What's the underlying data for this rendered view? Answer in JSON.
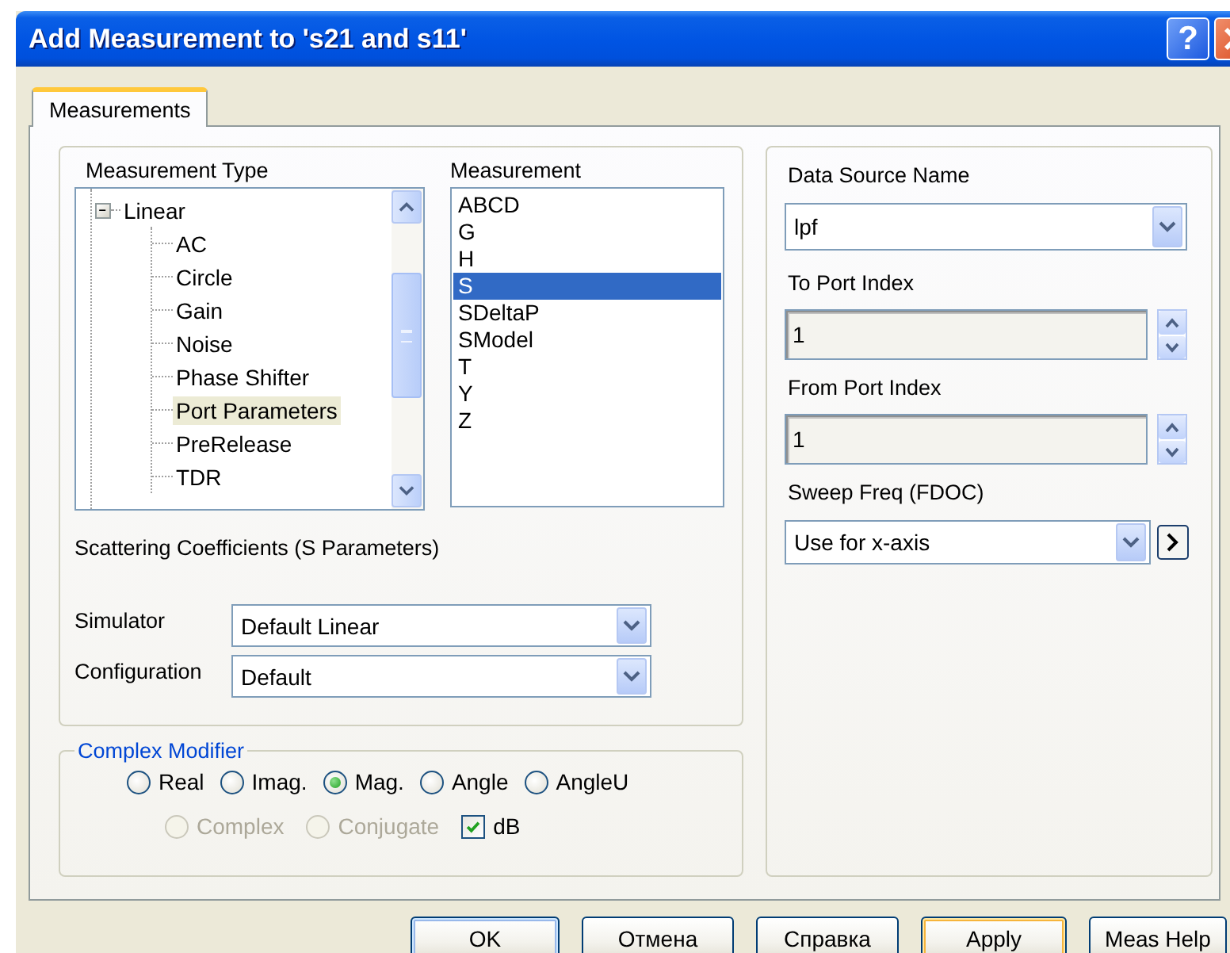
{
  "window": {
    "title": "Add Measurement to 's21 and s11'",
    "help_button": "?"
  },
  "tabs": [
    {
      "label": "Measurements",
      "selected": true
    }
  ],
  "measurement_type": {
    "label": "Measurement Type",
    "tree": [
      {
        "label": "Linear",
        "expanded": true,
        "selected": false,
        "children": [
          {
            "label": "AC",
            "selected": false
          },
          {
            "label": "Circle",
            "selected": false
          },
          {
            "label": "Gain",
            "selected": false
          },
          {
            "label": "Noise",
            "selected": false
          },
          {
            "label": "Phase Shifter",
            "selected": false
          },
          {
            "label": "Port Parameters",
            "selected": true
          },
          {
            "label": "PreRelease",
            "selected": false
          },
          {
            "label": "TDR",
            "selected": false
          }
        ]
      }
    ]
  },
  "measurement": {
    "label": "Measurement",
    "items": [
      {
        "label": "ABCD",
        "selected": false
      },
      {
        "label": "G",
        "selected": false
      },
      {
        "label": "H",
        "selected": false
      },
      {
        "label": "S",
        "selected": true
      },
      {
        "label": "SDeltaP",
        "selected": false
      },
      {
        "label": "SModel",
        "selected": false
      },
      {
        "label": "T",
        "selected": false
      },
      {
        "label": "Y",
        "selected": false
      },
      {
        "label": "Z",
        "selected": false
      }
    ]
  },
  "description": "Scattering Coefficients (S Parameters)",
  "simulator": {
    "label": "Simulator",
    "value": "Default Linear"
  },
  "configuration": {
    "label": "Configuration",
    "value": "Default"
  },
  "complex_modifier": {
    "title": "Complex Modifier",
    "row_1": [
      {
        "kind": "radio",
        "label": "Real",
        "selected": false,
        "disabled": false
      },
      {
        "kind": "radio",
        "label": "Imag.",
        "selected": false,
        "disabled": false
      },
      {
        "kind": "radio",
        "label": "Mag.",
        "selected": true,
        "disabled": false
      },
      {
        "kind": "radio",
        "label": "Angle",
        "selected": false,
        "disabled": false
      },
      {
        "kind": "radio",
        "label": "AngleU",
        "selected": false,
        "disabled": false
      }
    ],
    "row_2": [
      {
        "kind": "radio",
        "label": "Complex",
        "selected": false,
        "disabled": true
      },
      {
        "kind": "radio",
        "label": "Conjugate",
        "selected": false,
        "disabled": true
      },
      {
        "kind": "checkbox",
        "label": "dB",
        "checked": true,
        "disabled": false
      }
    ]
  },
  "fields": [
    {
      "kind": "combo",
      "label": "Data Source Name",
      "value": "lpf"
    },
    {
      "kind": "spin",
      "label": "To Port Index",
      "value": "1"
    },
    {
      "kind": "spin",
      "label": "From Port Index",
      "value": "1"
    },
    {
      "kind": "combo_more",
      "label": "Sweep Freq (FDOC)",
      "value": "Use for x-axis"
    }
  ],
  "buttons": [
    {
      "label": "OK",
      "kind": "default"
    },
    {
      "label": "Отмена",
      "kind": "normal"
    },
    {
      "label": "Справка",
      "kind": "normal"
    },
    {
      "label": "Apply",
      "kind": "hot"
    },
    {
      "label": "Meas Help",
      "kind": "normal"
    }
  ]
}
